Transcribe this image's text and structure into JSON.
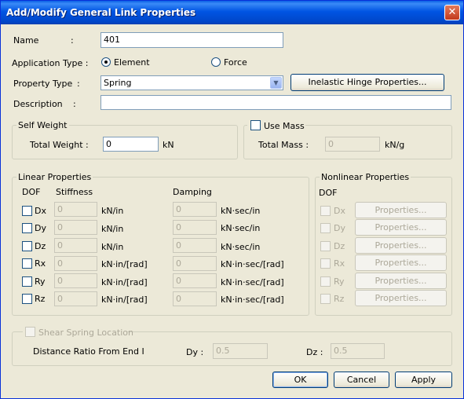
{
  "window": {
    "title": "Add/Modify General Link Properties"
  },
  "name": {
    "label": "Name",
    "colon": ":",
    "value": "401"
  },
  "application_type": {
    "label": "Application Type :",
    "options": [
      "Element",
      "Force"
    ],
    "selected": "Element"
  },
  "property_type": {
    "label": "Property Type",
    "colon": ":",
    "value": "Spring",
    "hinge_button": "Inelastic Hinge Properties..."
  },
  "description": {
    "label": "Description",
    "colon": ":",
    "value": ""
  },
  "self_weight": {
    "group": "Self Weight",
    "total_weight_label": "Total Weight :",
    "total_weight_value": "0",
    "unit": "kN"
  },
  "mass": {
    "use_mass_label": "Use Mass",
    "use_mass_checked": false,
    "total_mass_label": "Total Mass :",
    "total_mass_value": "0",
    "unit": "kN/g"
  },
  "linear": {
    "group": "Linear Properties",
    "dof_header": "DOF",
    "stiffness_header": "Stiffness",
    "damping_header": "Damping",
    "rows": [
      {
        "dof": "Dx",
        "stiffness": "0",
        "stiffness_unit": "kN/in",
        "damping": "0",
        "damping_unit": "kN·sec/in"
      },
      {
        "dof": "Dy",
        "stiffness": "0",
        "stiffness_unit": "kN/in",
        "damping": "0",
        "damping_unit": "kN·sec/in"
      },
      {
        "dof": "Dz",
        "stiffness": "0",
        "stiffness_unit": "kN/in",
        "damping": "0",
        "damping_unit": "kN·sec/in"
      },
      {
        "dof": "Rx",
        "stiffness": "0",
        "stiffness_unit": "kN·in/[rad]",
        "damping": "0",
        "damping_unit": "kN·in·sec/[rad]"
      },
      {
        "dof": "Ry",
        "stiffness": "0",
        "stiffness_unit": "kN·in/[rad]",
        "damping": "0",
        "damping_unit": "kN·in·sec/[rad]"
      },
      {
        "dof": "Rz",
        "stiffness": "0",
        "stiffness_unit": "kN·in/[rad]",
        "damping": "0",
        "damping_unit": "kN·in·sec/[rad]"
      }
    ]
  },
  "nonlinear": {
    "group": "Nonlinear Properties",
    "dof_header": "DOF",
    "rows": [
      {
        "dof": "Dx",
        "button": "Properties..."
      },
      {
        "dof": "Dy",
        "button": "Properties..."
      },
      {
        "dof": "Dz",
        "button": "Properties..."
      },
      {
        "dof": "Rx",
        "button": "Properties..."
      },
      {
        "dof": "Ry",
        "button": "Properties..."
      },
      {
        "dof": "Rz",
        "button": "Properties..."
      }
    ]
  },
  "shear_spring": {
    "label": "Shear Spring Location",
    "distance_label": "Distance Ratio From End I",
    "dy_label": "Dy :",
    "dy_value": "0.5",
    "dz_label": "Dz :",
    "dz_value": "0.5"
  },
  "buttons": {
    "ok": "OK",
    "cancel": "Cancel",
    "apply": "Apply"
  }
}
